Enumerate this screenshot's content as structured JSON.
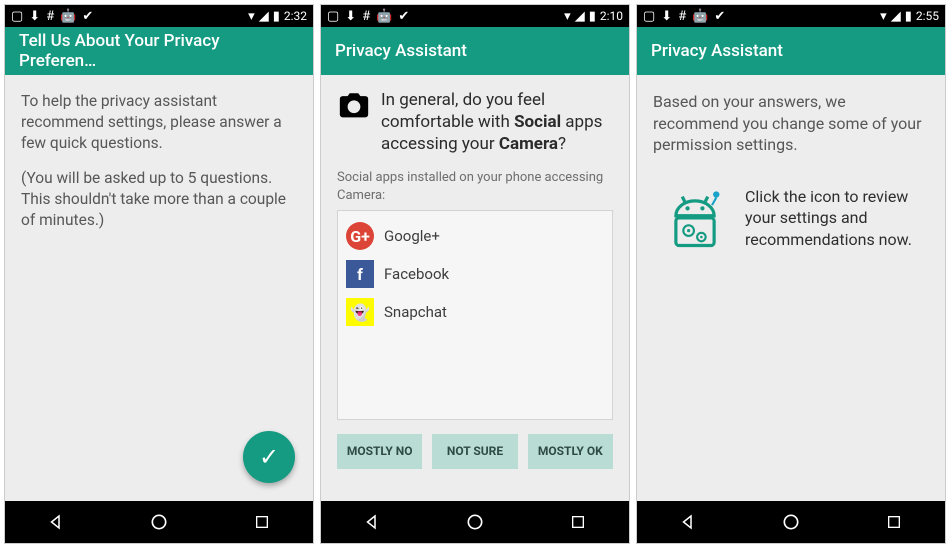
{
  "screens": [
    {
      "status": {
        "time": "2:32"
      },
      "title": "Tell Us About Your Privacy Preferen…",
      "intro1": "To help the privacy assistant recommend settings, please answer a few quick questions.",
      "intro2": "(You will be asked up to 5 questions. This shouldn't take more than a couple of minutes.)"
    },
    {
      "status": {
        "time": "2:10"
      },
      "title": "Privacy Assistant",
      "question_pre": "In general, do you feel comfortable with ",
      "question_bold1": "Social",
      "question_mid": " apps accessing your ",
      "question_bold2": "Camera",
      "question_post": "?",
      "apps_label": "Social apps installed on your phone accessing Camera:",
      "apps": [
        {
          "name": "Google+",
          "glyph": "G+",
          "cls": "icon-gplus"
        },
        {
          "name": "Facebook",
          "glyph": "f",
          "cls": "icon-fb"
        },
        {
          "name": "Snapchat",
          "glyph": "👻",
          "cls": "icon-snap"
        }
      ],
      "buttons": [
        "MOSTLY NO",
        "NOT SURE",
        "MOSTLY OK"
      ]
    },
    {
      "status": {
        "time": "2:55"
      },
      "title": "Privacy Assistant",
      "rec_text": "Based on your answers, we recommend you change some of your permission settings.",
      "rec_cta": "Click the icon to review your settings and recommendations now."
    }
  ],
  "colors": {
    "accent": "#149b82"
  }
}
